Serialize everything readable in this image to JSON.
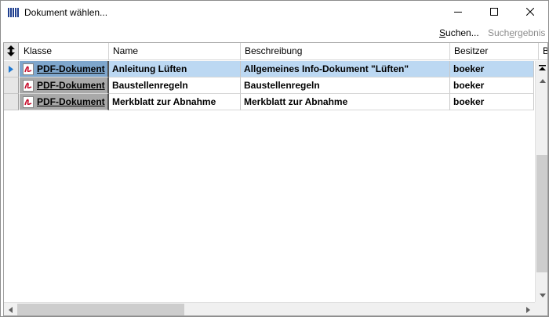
{
  "window": {
    "title": "Dokument wählen...",
    "app_icon": "library-icon",
    "controls": [
      "minimize-icon",
      "maximize-icon",
      "close-icon"
    ]
  },
  "toolbar": {
    "search_label": "Suchen...",
    "search_mnemonic": "S",
    "search_rest": "uchen...",
    "result_label": "Suchergebnis",
    "result_pre": "Such",
    "result_mnemonic": "e",
    "result_rest": "rgebnis"
  },
  "table": {
    "columns": [
      "Klasse",
      "Name",
      "Beschreibung",
      "Besitzer",
      "B"
    ],
    "rows": [
      {
        "klasse": "PDF-Dokument",
        "name": "Anleitung Lüften",
        "beschreibung": "Allgemeines Info-Dokument \"Lüften\"",
        "besitzer": "boeker",
        "selected": true
      },
      {
        "klasse": "PDF-Dokument",
        "name": "Baustellenregeln",
        "beschreibung": "Baustellenregeln",
        "besitzer": "boeker",
        "selected": false
      },
      {
        "klasse": "PDF-Dokument",
        "name": "Merkblatt  zur Abnahme",
        "beschreibung": "Merkblatt  zur Abnahme",
        "besitzer": "boeker",
        "selected": false
      }
    ]
  },
  "colors": {
    "selection": "#bcd8f2",
    "klasse_selected": "#7ea6cc",
    "klasse_normal": "#a9a9a9",
    "row_indicator": "#1e78d2",
    "pdf_red": "#c8102e"
  }
}
